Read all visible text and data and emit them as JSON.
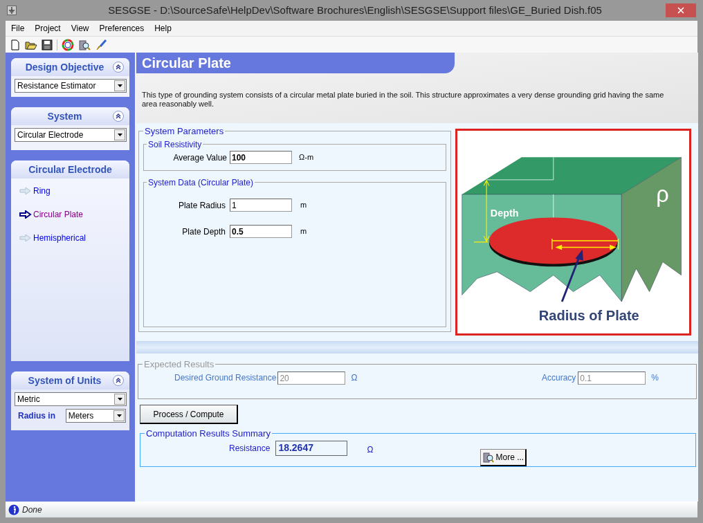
{
  "window": {
    "title": "SESGSE - D:\\SourceSafe\\HelpDev\\Software Brochures\\English\\SESGSE\\Support files\\GE_Buried Dish.f05"
  },
  "menu": [
    "File",
    "Project",
    "View",
    "Preferences",
    "Help"
  ],
  "sidebar": {
    "design_objective": {
      "title": "Design Objective",
      "value": "Resistance Estimator"
    },
    "system": {
      "title": "System",
      "value": "Circular Electrode"
    },
    "electrode": {
      "title": "Circular Electrode",
      "items": [
        {
          "label": "Ring",
          "selected": false
        },
        {
          "label": "Circular Plate",
          "selected": true
        },
        {
          "label": "Hemispherical",
          "selected": false
        }
      ]
    },
    "units": {
      "title": "System of Units",
      "value": "Metric",
      "radius_label": "Radius in",
      "radius_value": "Meters"
    }
  },
  "page": {
    "title": "Circular Plate",
    "description": "This type of grounding system consists of a circular metal plate buried in the soil. This structure approximates a very dense grounding grid having the same area reasonably well."
  },
  "system_parameters": {
    "title": "System Parameters",
    "soil": {
      "title": "Soil Resistivity",
      "label": "Average Value",
      "value": "100",
      "unit": "Ω-m"
    },
    "data": {
      "title": "System Data (Circular Plate)",
      "fields": [
        {
          "label": "Plate Radius",
          "value": "1",
          "unit": "m",
          "bold": false
        },
        {
          "label": "Plate Depth",
          "value": "0.5",
          "unit": "m",
          "bold": true
        }
      ]
    }
  },
  "diagram": {
    "depth_label": "Depth",
    "rho_label": "ρ",
    "radius_label": "Radius of Plate"
  },
  "expected_results": {
    "title": "Expected Results",
    "disabled": true,
    "resistance": {
      "label": "Desired Ground Resistance",
      "value": "20",
      "unit": "Ω"
    },
    "accuracy": {
      "label": "Accuracy",
      "value": "0.1",
      "unit": "%"
    }
  },
  "process_button": "Process / Compute",
  "summary": {
    "title": "Computation Results Summary",
    "label": "Resistance",
    "value": "18.2647",
    "unit": "Ω",
    "more_button": "More ..."
  },
  "status_bar": "Done"
}
